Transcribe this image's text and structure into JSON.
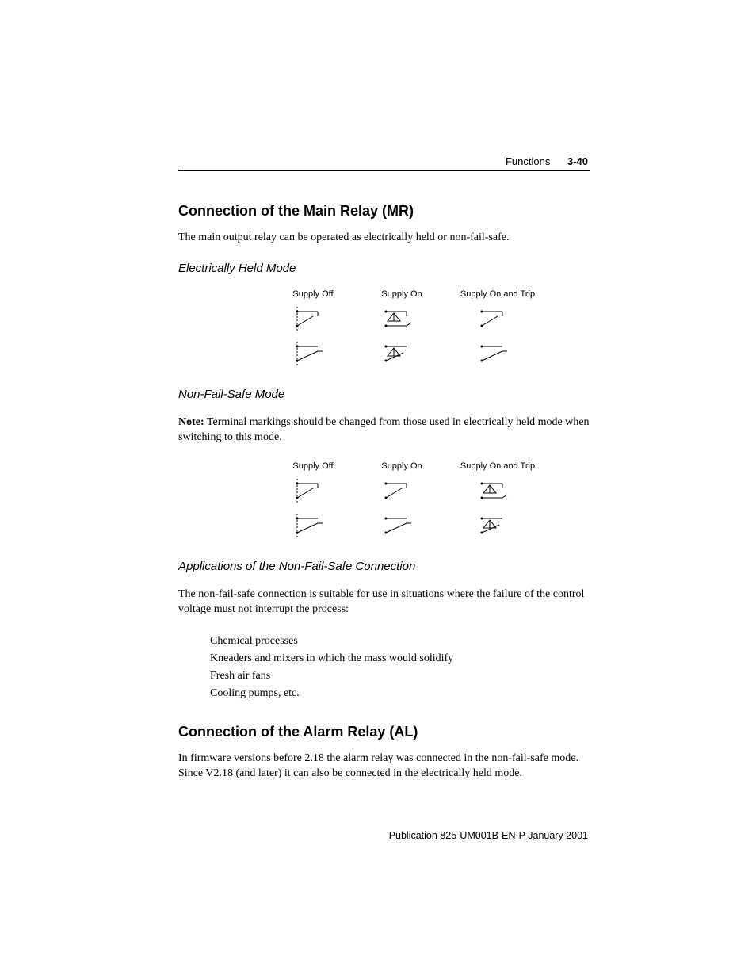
{
  "header": {
    "section": "Functions",
    "page": "3-40"
  },
  "section1": {
    "title": "Connection of the Main Relay (MR)",
    "intro": "The main output relay can be operated as electrically held or non-fail-safe.",
    "mode1": {
      "title": "Electrically Held Mode",
      "cols": [
        "Supply Off",
        "Supply On",
        "Supply On and Trip"
      ]
    },
    "mode2": {
      "title": "Non-Fail-Safe Mode",
      "note_label": "Note:",
      "note_body": " Terminal markings should be changed from those used in electrically held mode when switching to this mode.",
      "cols": [
        "Supply Off",
        "Supply On",
        "Supply On and Trip"
      ]
    },
    "apps": {
      "title": "Applications of the Non-Fail-Safe Connection",
      "intro": "The non-fail-safe connection is suitable for use in situations where the failure of the control voltage must not interrupt the process:",
      "items": [
        "Chemical processes",
        "Kneaders and mixers in which the mass would solidify",
        "Fresh air fans",
        "Cooling pumps, etc."
      ]
    }
  },
  "section2": {
    "title": "Connection of the Alarm Relay (AL)",
    "intro": "In firmware versions before 2.18 the alarm relay was connected in the non-fail-safe mode. Since V2.18 (and later) it can also be connected in the electrically held mode."
  },
  "footer": "Publication 825-UM001B-EN-P  January 2001"
}
